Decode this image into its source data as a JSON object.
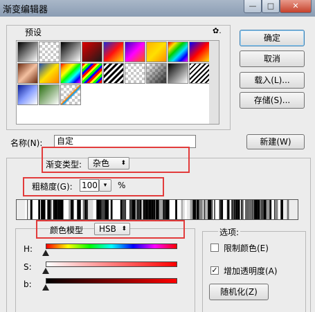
{
  "window": {
    "title": "渐变编辑器",
    "min_label": "—",
    "max_label": "□",
    "close_label": "✕"
  },
  "presets": {
    "label": "预设",
    "menu_icon": "gear-icon",
    "menu_glyph": "✿.",
    "swatches": [
      {
        "style": "linear-gradient(135deg,#000,#fff)"
      },
      {
        "style": "checker-black"
      },
      {
        "style": "linear-gradient(135deg,#000,#fff)"
      },
      {
        "style": "linear-gradient(135deg,#e00000,#1a1a1a)"
      },
      {
        "style": "linear-gradient(135deg,#1e2bd8,#ff1010,#ffe000)"
      },
      {
        "style": "linear-gradient(135deg,#3a00c8,#ff00ff,#ff5a00)"
      },
      {
        "style": "linear-gradient(135deg,#ffb000,#ffe000,#ff8c00)"
      },
      {
        "style": "linear-gradient(135deg,#ff0000,#ffe000,#00d000,#00e0ff,#0000ff,#ff00ff)"
      },
      {
        "style": "linear-gradient(135deg,#0000ff,#ff0000,#ffe000)"
      },
      {
        "style": "linear-gradient(135deg,#6a2a10,#f4c0a0,#6a2a10)"
      },
      {
        "style": "linear-gradient(135deg,#1d4cb0,#ffe000,#ff8000)"
      },
      {
        "style": "linear-gradient(135deg,#ff0000,#ffa500,#ffff00,#00ff00,#00ffff,#0000ff,#ff00ff)"
      },
      {
        "style": "repeating-linear-gradient(135deg,#ff0000 0 3px,#ffff00 3px 6px,#00ff00 6px 9px,#0000ff 9px 12px)"
      },
      {
        "style": "repeating-linear-gradient(135deg,#000 0 3px,#fff 3px 6px)"
      },
      {
        "style": "checker-gray"
      },
      {
        "style": "checker-gray2"
      },
      {
        "style": "linear-gradient(135deg,#000,#fff)"
      },
      {
        "style": "repeating-linear-gradient(135deg,#000 0 2px,#fff 2px 5px)"
      },
      {
        "style": "linear-gradient(135deg,#0a1e9a,#8aa0ff,#fff)"
      },
      {
        "style": "linear-gradient(135deg,#2a6e10,#ffffff)"
      },
      {
        "style": "checker-rainbow"
      }
    ]
  },
  "buttons": {
    "ok": "确定",
    "cancel": "取消",
    "load": "载入(L)...",
    "save": "存储(S)...",
    "new": "新建(W)",
    "randomize": "随机化(Z)"
  },
  "name": {
    "label": "名称(N):",
    "value": "自定"
  },
  "gradient_type": {
    "label": "渐变类型:",
    "value": "杂色"
  },
  "roughness": {
    "label": "粗糙度(G):",
    "value": "100",
    "unit": "%"
  },
  "color_model": {
    "label": "颜色模型",
    "value": "HSB",
    "sliders": [
      {
        "label": "H:",
        "track_icon": "hue-spectrum",
        "level": 0
      },
      {
        "label": "S:",
        "track_icon": "saturation-gradient",
        "level": 0
      },
      {
        "label": "b:",
        "track_icon": "brightness-gradient",
        "level": 0
      }
    ]
  },
  "options": {
    "label": "选项:",
    "restrict_colors": {
      "label": "限制颜色(E)",
      "checked": false
    },
    "add_transparency": {
      "label": "增加透明度(A)",
      "checked": true,
      "check_glyph": "✓"
    }
  },
  "colors": {
    "highlight_red": "#e23b3b",
    "title_bar": "#9aabc0"
  }
}
